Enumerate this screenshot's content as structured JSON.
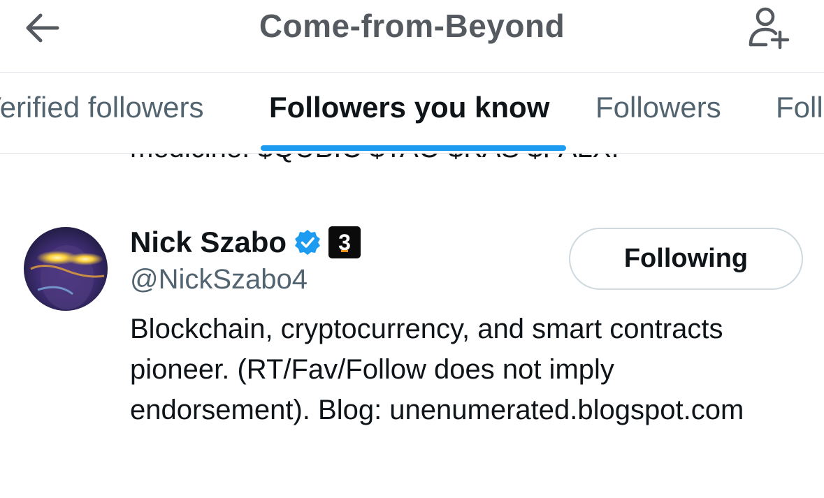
{
  "header": {
    "title": "Come-from-Beyond",
    "back_icon": "arrow-left-icon",
    "add_icon": "add-user-icon"
  },
  "tabs": [
    {
      "label": "Verified followers",
      "active": false
    },
    {
      "label": "Followers you know",
      "active": true
    },
    {
      "label": "Followers",
      "active": false
    },
    {
      "label": "Following",
      "active": false
    }
  ],
  "previous_bio_tail": "medicine. $QUBIC $TAO $KAS $FALX.",
  "user": {
    "name": "Nick Szabo",
    "handle": "@NickSzabo4",
    "badge_label": "3",
    "follow_label": "Following",
    "bio": "Blockchain, cryptocurrency, and smart contracts pioneer. (RT/Fav/Follow does not imply endorsement). Blog: unenumerated.blogspot.com"
  },
  "colors": {
    "accent": "#1d9bf0",
    "text": "#0f1419",
    "secondary": "#536471",
    "border": "#cfd9de"
  }
}
